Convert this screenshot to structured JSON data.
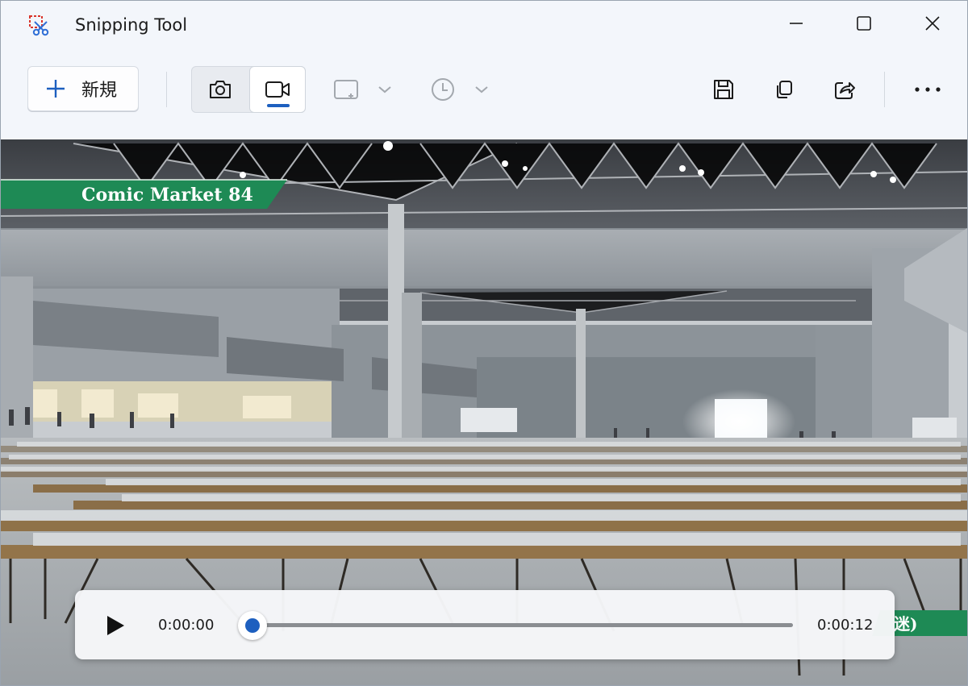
{
  "window": {
    "title": "Snipping Tool",
    "icon": "snipping-tool-icon",
    "controls": [
      "minimize-icon",
      "maximize-icon",
      "close-icon"
    ]
  },
  "toolbar": {
    "new_label": "新規",
    "modes": [
      {
        "icon": "camera-icon",
        "active": false
      },
      {
        "icon": "video-camera-icon",
        "active": true
      }
    ],
    "capture_area_icon": "rectangle-snip-icon",
    "delay_icon": "clock-icon",
    "actions": [
      "save-icon",
      "copy-icon",
      "share-icon",
      "more-icon"
    ]
  },
  "video": {
    "caption": "Comic Market 84",
    "caption_bottom_right": "迷)"
  },
  "player": {
    "current_time": "0:00:00",
    "total_time": "0:00:12",
    "progress": 0,
    "play_icon": "play-icon"
  },
  "colors": {
    "accent": "#1d5fbf",
    "caption_green": "#1e8a55"
  }
}
